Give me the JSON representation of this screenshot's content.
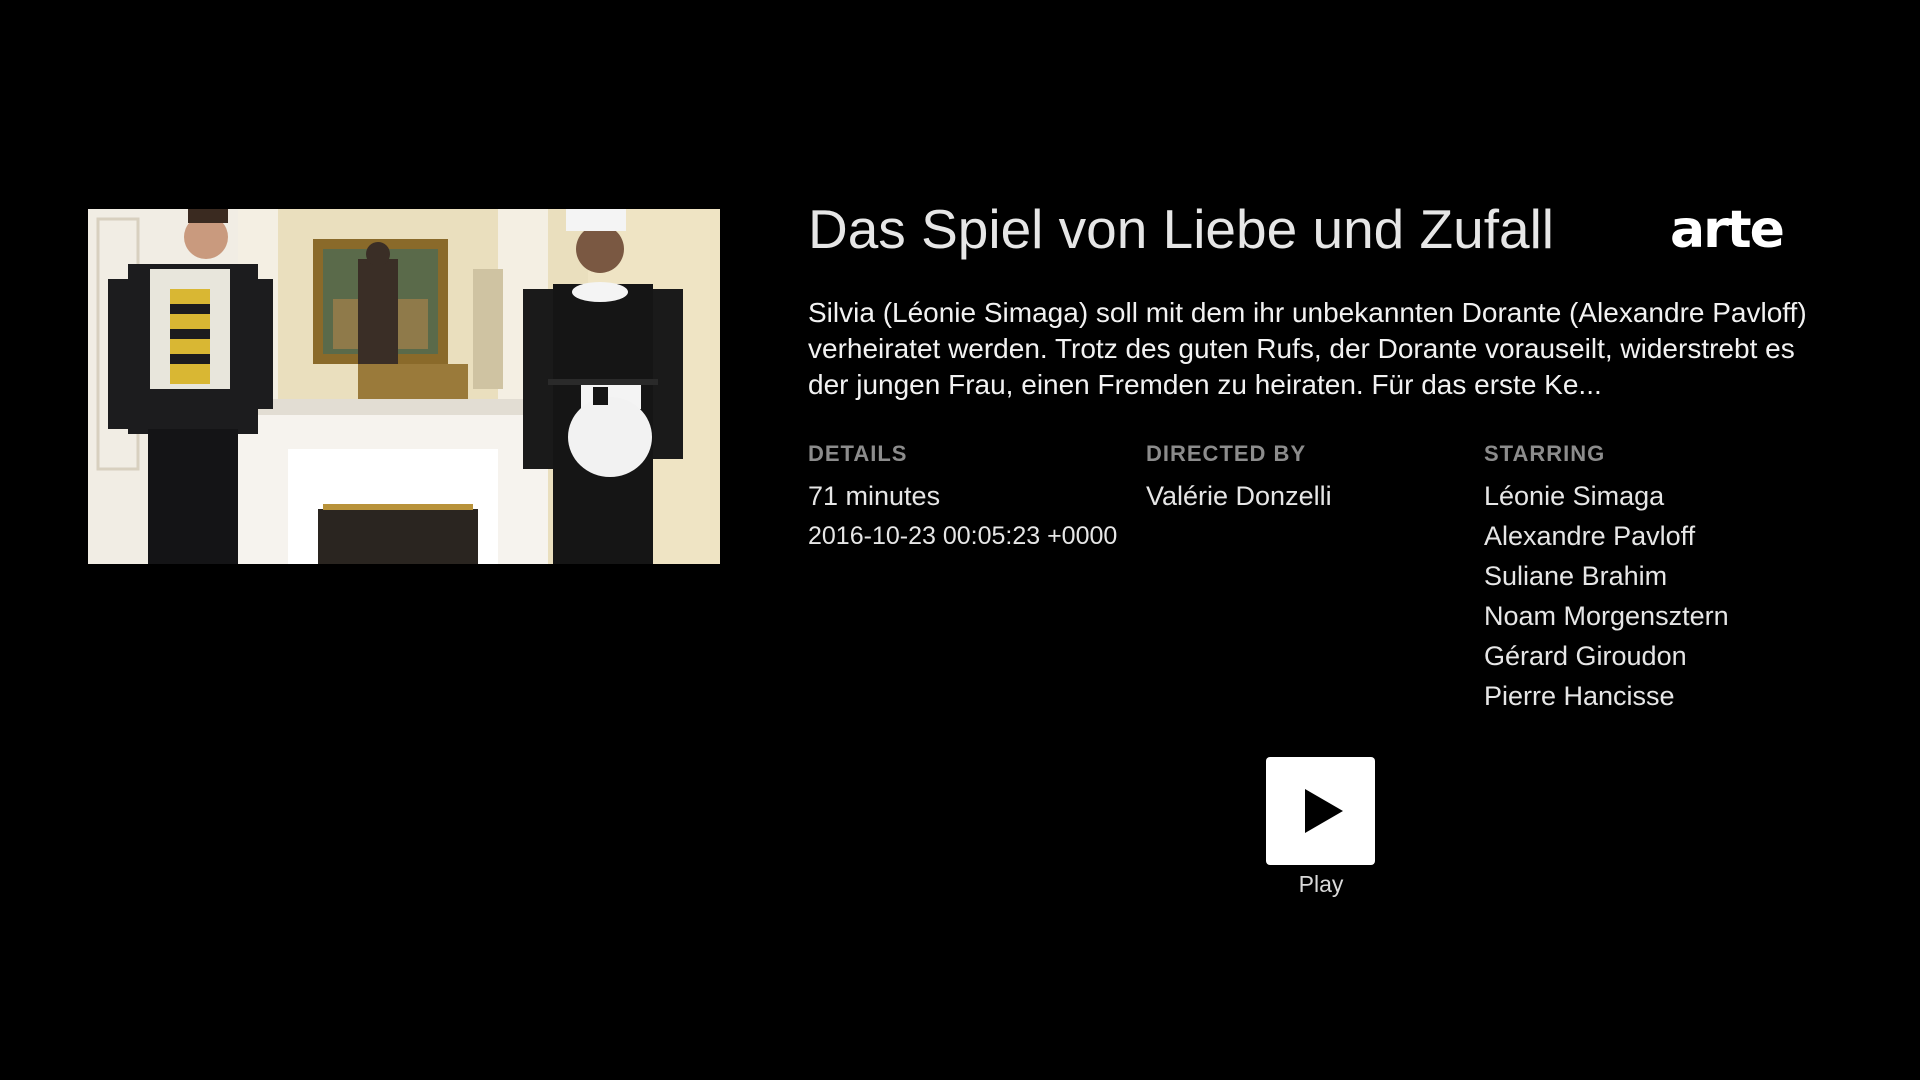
{
  "movie": {
    "title": "Das Spiel von Liebe und Zufall",
    "channel_logo": "arte",
    "description": "Silvia (Léonie Simaga) soll mit dem ihr unbekannten Dorante (Alexandre Pavloff) verheiratet werden. Trotz des guten Rufs, der Dorante vorauseilt, widerstrebt es der jungen Frau, einen Fremden zu heiraten. Für das erste Ke...",
    "poster_alt": "movie-still"
  },
  "details": {
    "heading": "DETAILS",
    "duration": "71 minutes",
    "air_date": "2016-10-23 00:05:23 +0000"
  },
  "director": {
    "heading": "DIRECTED BY",
    "name": "Valérie Donzelli"
  },
  "starring": {
    "heading": "STARRING",
    "cast": [
      "Léonie Simaga",
      "Alexandre Pavloff",
      "Suliane Brahim",
      "Noam Morgensztern",
      "Gérard Giroudon",
      "Pierre Hancisse"
    ]
  },
  "actions": {
    "play_label": "Play",
    "play_icon": "play-icon"
  },
  "colors": {
    "background": "#000000",
    "heading_gray": "#8c8c8c",
    "text": "#e6e6e6",
    "button": "#ffffff"
  }
}
